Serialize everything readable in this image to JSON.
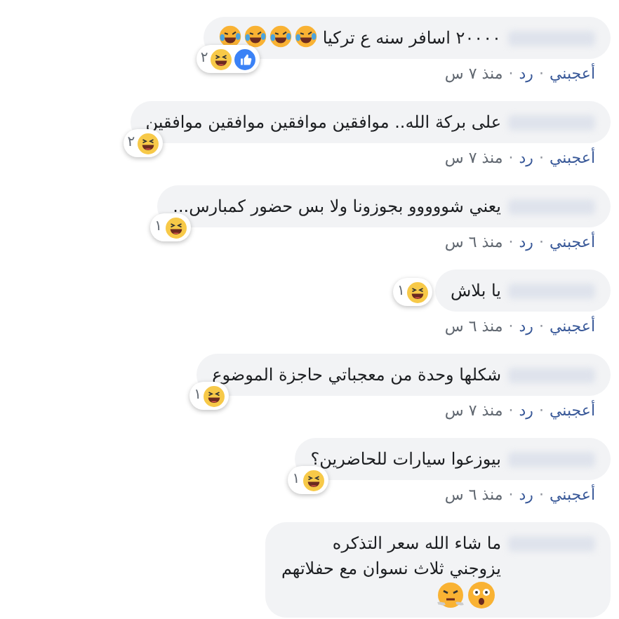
{
  "comments": [
    {
      "text": "٢٠٠٠٠ اسافر سنه ع تركيا",
      "emojis": [
        {
          "kind": "rofl"
        },
        {
          "kind": "rofl"
        },
        {
          "kind": "rofl"
        },
        {
          "kind": "rofl"
        }
      ],
      "reactions": {
        "kind": "below",
        "icons": [
          {
            "kind": "like"
          },
          {
            "kind": "haha"
          }
        ],
        "count": "٢"
      },
      "actions": [
        {
          "kind": "link",
          "text": "أعجبني"
        },
        {
          "kind": "separator",
          "text": "·"
        },
        {
          "kind": "link",
          "text": "رد"
        },
        {
          "kind": "separator",
          "text": "·"
        },
        {
          "kind": "time",
          "text": "منذ ٧ س"
        }
      ]
    },
    {
      "text": "على بركة الله.. موافقين موافقين موافقين موافقين",
      "reactions": {
        "kind": "below",
        "icons": [
          {
            "kind": "haha"
          }
        ],
        "count": "٢"
      },
      "actions": [
        {
          "kind": "link",
          "text": "أعجبني"
        },
        {
          "kind": "separator",
          "text": "·"
        },
        {
          "kind": "link",
          "text": "رد"
        },
        {
          "kind": "separator",
          "text": "·"
        },
        {
          "kind": "time",
          "text": "منذ ٧ س"
        }
      ]
    },
    {
      "text": "يعني شووووو بجوزونا ولا بس حضور كمبارس...",
      "reactions": {
        "kind": "below",
        "icons": [
          {
            "kind": "haha"
          }
        ],
        "count": "١"
      },
      "actions": [
        {
          "kind": "link",
          "text": "أعجبني"
        },
        {
          "kind": "separator",
          "text": "·"
        },
        {
          "kind": "link",
          "text": "رد"
        },
        {
          "kind": "separator",
          "text": "·"
        },
        {
          "kind": "time",
          "text": "منذ ٦ س"
        }
      ]
    },
    {
      "text": "يا بلاش",
      "reactions": {
        "kind": "beside",
        "icons": [
          {
            "kind": "haha"
          }
        ],
        "count": "١"
      },
      "actions": [
        {
          "kind": "link",
          "text": "أعجبني"
        },
        {
          "kind": "separator",
          "text": "·"
        },
        {
          "kind": "link",
          "text": "رد"
        },
        {
          "kind": "separator",
          "text": "·"
        },
        {
          "kind": "time",
          "text": "منذ ٦ س"
        }
      ]
    },
    {
      "text": "شكلها وحدة من معجباتي حاجزة الموضوع",
      "reactions": {
        "kind": "below",
        "icons": [
          {
            "kind": "haha"
          }
        ],
        "count": "١"
      },
      "actions": [
        {
          "kind": "link",
          "text": "أعجبني"
        },
        {
          "kind": "separator",
          "text": "·"
        },
        {
          "kind": "link",
          "text": "رد"
        },
        {
          "kind": "separator",
          "text": "·"
        },
        {
          "kind": "time",
          "text": "منذ ٧ س"
        }
      ]
    },
    {
      "text": "بيوزعوا سيارات للحاضرين؟",
      "reactions": {
        "kind": "below",
        "icons": [
          {
            "kind": "haha"
          }
        ],
        "count": "١"
      },
      "actions": [
        {
          "kind": "link",
          "text": "أعجبني"
        },
        {
          "kind": "separator",
          "text": "·"
        },
        {
          "kind": "link",
          "text": "رد"
        },
        {
          "kind": "separator",
          "text": "·"
        },
        {
          "kind": "time",
          "text": "منذ ٦ س"
        }
      ]
    },
    {
      "text": "ما شاء الله سعر التذكره\nيزوجني ثلاث نسوان مع حفلاتهم",
      "emojis": [
        {
          "kind": "astonished"
        },
        {
          "kind": "steam"
        }
      ]
    }
  ]
}
